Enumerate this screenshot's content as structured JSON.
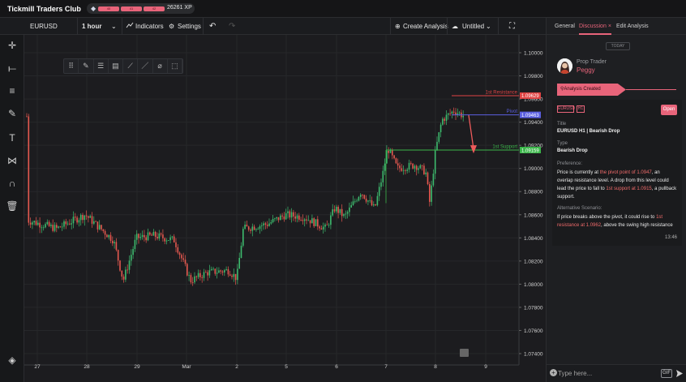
{
  "app": {
    "title": "Tickmill Traders Club",
    "xp": "26261 XP",
    "level_marks": [
      "40",
      "41",
      "42"
    ]
  },
  "toolbar": {
    "symbol": "EURUSD",
    "timeframe": "1 hour",
    "indicators": "Indicators",
    "settings": "Settings",
    "create_analysis": "Create Analysis",
    "layout_name": "Untitled"
  },
  "left_tools": [
    "crosshair-icon",
    "horizontal-line-icon",
    "parallel-channel-icon",
    "brush-icon",
    "text-icon",
    "pattern-icon",
    "magnet-icon",
    "trash-icon",
    "layers-icon"
  ],
  "drawing_tools": [
    "drag-handle-icon",
    "pencil-icon",
    "lines-icon",
    "style-icon",
    "line-style-icon",
    "ruler-icon",
    "eraser-icon",
    "selection-icon"
  ],
  "chart_data": {
    "type": "candlestick",
    "symbol": "EURUSD",
    "timeframe": "1 hour",
    "price_axis": [
      "1.10000",
      "1.09800",
      "1.09600",
      "1.09400",
      "1.09200",
      "1.09000",
      "1.08800",
      "1.08600",
      "1.08400",
      "1.08200",
      "1.08000",
      "1.07800",
      "1.07600",
      "1.07400"
    ],
    "time_axis": [
      "27",
      "28",
      "29",
      "Mar",
      "2",
      "5",
      "6",
      "7",
      "8",
      "9"
    ],
    "ylim": [
      1.0735,
      1.1005
    ],
    "grid": true,
    "levels": [
      {
        "name": "1st Resistance",
        "price": 1.09629,
        "label": "1.09629",
        "color": "#e04444"
      },
      {
        "name": "Pivot",
        "price": 1.09463,
        "label": "1.09463",
        "color": "#5b5fe0"
      },
      {
        "name": "1st Support",
        "price": 1.09159,
        "label": "1.09159",
        "color": "#3bb64a"
      }
    ],
    "projection": "down arrow toward 1st Support",
    "candle_colors": {
      "up": "#3dbb6e",
      "down": "#e5584f"
    }
  },
  "panel": {
    "tabs": [
      "General",
      "Discussion",
      "Edit Analysis"
    ],
    "today": "TODAY",
    "author_role": "Prop Trader",
    "author_name": "Peggy",
    "status": "Analysis Created",
    "badge_symbol": "EURUSD",
    "badge_tf": "H1",
    "open_button": "Open",
    "title_label": "Title",
    "title_value": "EURUSD H1 | Bearish Drop",
    "type_label": "Type",
    "type_value": "Bearish Drop",
    "preference_label": "Preference:",
    "pref_1": "Price is currently at ",
    "pref_hl_1": "the pivot point of 1.0947",
    "pref_2": ", an overlap resistance level. A drop from this level could lead the price to fall to ",
    "pref_hl_2": "1st support at 1.0915",
    "pref_3": ", a pullback support.",
    "alt_label": "Alternative Scenario:",
    "alt_1": "If price breaks above the pivot, it could rise to ",
    "alt_hl": "1st resistance at 1.0962",
    "alt_2": ", above the swing high resistance",
    "time": "13:46",
    "chat_placeholder": "Type here...",
    "gif": "GIF"
  }
}
